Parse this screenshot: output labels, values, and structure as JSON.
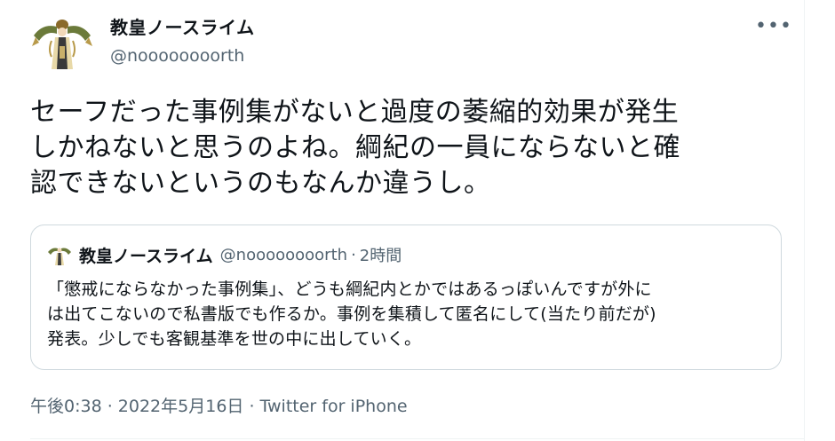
{
  "author": {
    "name": "教皇ノースライム",
    "handle": "@noooooooorth"
  },
  "tweet": {
    "text": "セーフだった事例集がないと過度の萎縮的効果が発生\nしかねないと思うのよね。綱紀の一員にならないと確\n認できないというのもなんか違うし。"
  },
  "quote": {
    "name": "教皇ノースライム",
    "handle": "@noooooooorth",
    "separator": "·",
    "time": "2時間",
    "text": "「懲戒にならなかった事例集」、どうも綱紀内とかではあるっぽいんですが外に\nは出てこないので私書版でも作るか。事例を集積して匿名にして(当たり前だが)\n発表。少しでも客観基準を世の中に出していく。"
  },
  "meta": {
    "time": "午後0:38",
    "separator1": " · ",
    "date": "2022年5月16日",
    "separator2": " · ",
    "source": "Twitter for iPhone"
  },
  "icons": {
    "more": "more-icon",
    "avatar": "avatar-illustration"
  },
  "colors": {
    "text": "#0f1419",
    "secondary": "#536471",
    "border": "#cfd9de"
  }
}
